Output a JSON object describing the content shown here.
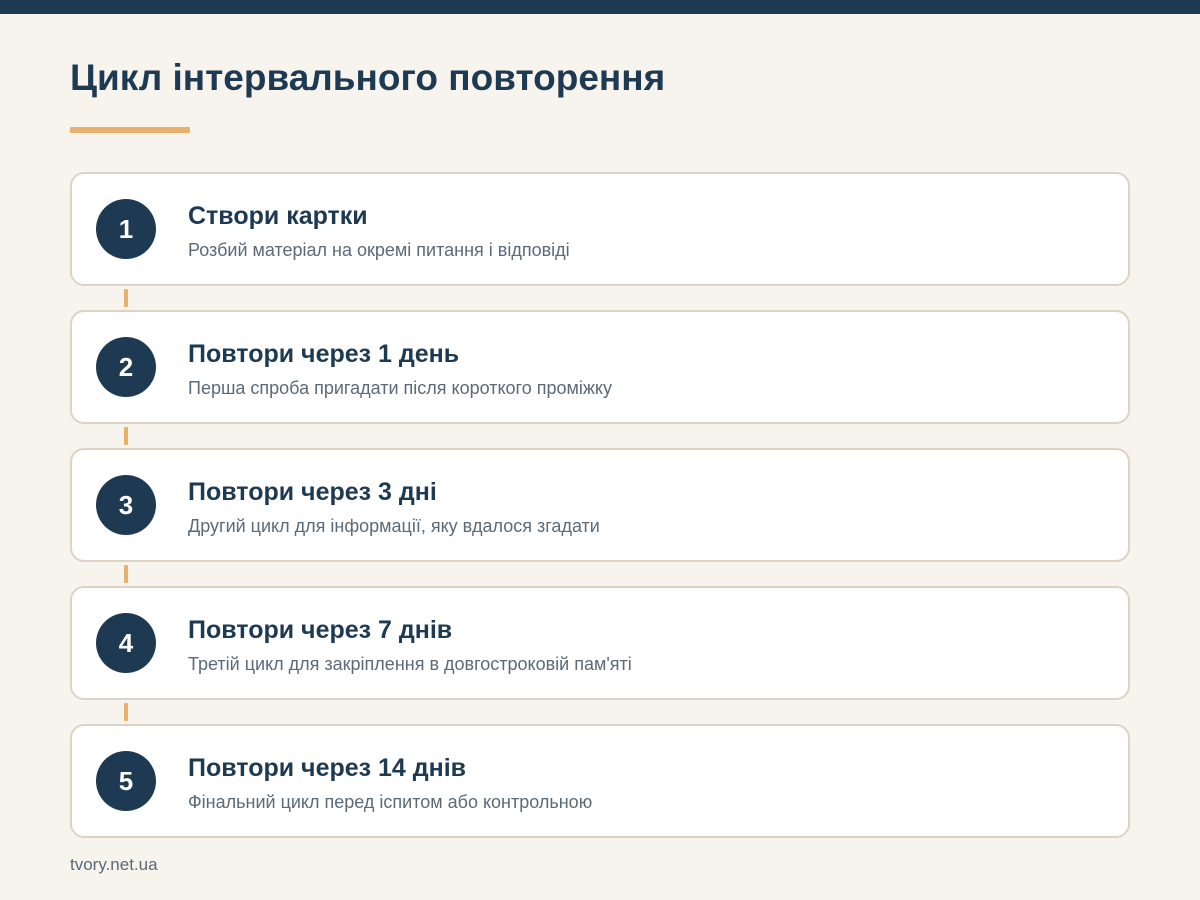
{
  "colors": {
    "primary": "#1e3a52",
    "accent": "#e8b06a",
    "background": "#f7f4ee",
    "card_border": "#dcd3c4",
    "muted_text": "#5a6a78"
  },
  "header": {
    "title": "Цикл інтервального повторення"
  },
  "steps": [
    {
      "number": "1",
      "title": "Створи картки",
      "description": "Розбий матеріал на окремі питання і відповіді"
    },
    {
      "number": "2",
      "title": "Повтори через 1 день",
      "description": "Перша спроба пригадати після короткого проміжку"
    },
    {
      "number": "3",
      "title": "Повтори через 3 дні",
      "description": "Другий цикл для інформації, яку вдалося згадати"
    },
    {
      "number": "4",
      "title": "Повтори через 7 днів",
      "description": "Третій цикл для закріплення в довгостроковій пам'яті"
    },
    {
      "number": "5",
      "title": "Повтори через 14 днів",
      "description": "Фінальний цикл перед іспитом або контрольною"
    }
  ],
  "footer": {
    "source": "tvory.net.ua"
  }
}
